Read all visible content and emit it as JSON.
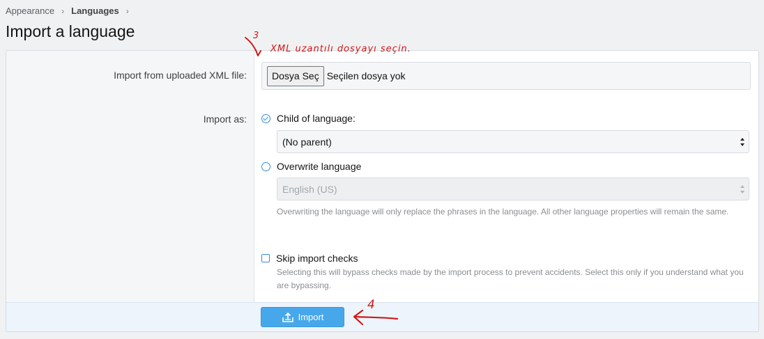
{
  "breadcrumb": {
    "items": [
      "Appearance",
      "Languages"
    ]
  },
  "page": {
    "title": "Import a language"
  },
  "form": {
    "upload_label": "Import from uploaded XML file:",
    "file_button_label": "Dosya Seç",
    "file_status": "Seçilen dosya yok",
    "import_as_label": "Import as:",
    "child_option_label": "Child of language:",
    "child_select_value": "(No parent)",
    "overwrite_option_label": "Overwrite language",
    "overwrite_select_value": "English (US)",
    "overwrite_hint": "Overwriting the language will only replace the phrases in the language. All other language properties will remain the same.",
    "skip_checks_label": "Skip import checks",
    "skip_checks_hint": "Selecting this will bypass checks made by the import process to prevent accidents. Select this only if you understand what you are bypassing.",
    "import_button_label": "Import"
  },
  "annotations": {
    "step3_number": "3",
    "step3_text": "XML uzantılı dosyayı seçin.",
    "step4_number": "4"
  },
  "colors": {
    "accent": "#47a7eb",
    "annotation": "#d01818"
  }
}
